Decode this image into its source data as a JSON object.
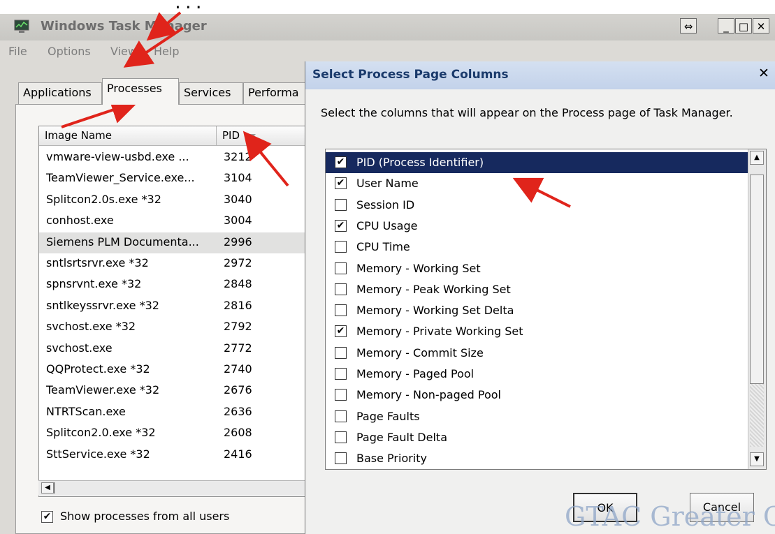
{
  "caption": "...",
  "window": {
    "title": "Windows Task Manager",
    "buttons": {
      "resize": "⇔",
      "minimize": "_",
      "maximize": "□",
      "close": "✕"
    }
  },
  "menu": [
    "File",
    "Options",
    "View",
    "Help"
  ],
  "tabs": [
    "Applications",
    "Processes",
    "Services",
    "Performa"
  ],
  "process_list": {
    "columns": {
      "image_name": "Image Name",
      "pid": "PID"
    },
    "rows": [
      {
        "name": "vmware-view-usbd.exe ...",
        "pid": "3212"
      },
      {
        "name": "TeamViewer_Service.exe...",
        "pid": "3104"
      },
      {
        "name": "Splitcon2.0s.exe *32",
        "pid": "3040"
      },
      {
        "name": "conhost.exe",
        "pid": "3004"
      },
      {
        "name": "Siemens PLM Documenta...",
        "pid": "2996"
      },
      {
        "name": "sntlsrtsrvr.exe *32",
        "pid": "2972"
      },
      {
        "name": "spnsrvnt.exe *32",
        "pid": "2848"
      },
      {
        "name": "sntlkeyssrvr.exe *32",
        "pid": "2816"
      },
      {
        "name": "svchost.exe *32",
        "pid": "2792"
      },
      {
        "name": "svchost.exe",
        "pid": "2772"
      },
      {
        "name": "QQProtect.exe *32",
        "pid": "2740"
      },
      {
        "name": "TeamViewer.exe *32",
        "pid": "2676"
      },
      {
        "name": "NTRTScan.exe",
        "pid": "2636"
      },
      {
        "name": "Splitcon2.0.exe *32",
        "pid": "2608"
      },
      {
        "name": "SttService.exe *32",
        "pid": "2416"
      }
    ],
    "selected_row": 4
  },
  "show_all": {
    "label": "Show processes from all users",
    "checked": true,
    "mark": "✔"
  },
  "dialog": {
    "title": "Select Process Page Columns",
    "close": "✕",
    "description": "Select the columns that will appear on the Process page of Task Manager.",
    "columns": [
      {
        "label": "PID (Process Identifier)",
        "checked": true,
        "mark": "✔"
      },
      {
        "label": "User Name",
        "checked": true,
        "mark": "✔"
      },
      {
        "label": "Session ID",
        "checked": false,
        "mark": ""
      },
      {
        "label": "CPU Usage",
        "checked": true,
        "mark": "✔"
      },
      {
        "label": "CPU Time",
        "checked": false,
        "mark": ""
      },
      {
        "label": "Memory - Working Set",
        "checked": false,
        "mark": ""
      },
      {
        "label": "Memory - Peak Working Set",
        "checked": false,
        "mark": ""
      },
      {
        "label": "Memory - Working Set Delta",
        "checked": false,
        "mark": ""
      },
      {
        "label": "Memory - Private Working Set",
        "checked": true,
        "mark": "✔"
      },
      {
        "label": "Memory - Commit Size",
        "checked": false,
        "mark": ""
      },
      {
        "label": "Memory - Paged Pool",
        "checked": false,
        "mark": ""
      },
      {
        "label": "Memory - Non-paged Pool",
        "checked": false,
        "mark": ""
      },
      {
        "label": "Page Faults",
        "checked": false,
        "mark": ""
      },
      {
        "label": "Page Fault Delta",
        "checked": false,
        "mark": ""
      },
      {
        "label": "Base Priority",
        "checked": false,
        "mark": ""
      }
    ],
    "selected_index": 0,
    "ok": "OK",
    "cancel": "Cancel"
  },
  "watermark": "GTAC Greater Ch",
  "colors": {
    "selection": "#16295e",
    "arrow": "#e0241b",
    "window_bg": "#dcdad6"
  },
  "icons": [
    "task-manager-icon",
    "sort-descending-icon",
    "scroll-up-icon",
    "scroll-down-icon",
    "scroll-left-icon",
    "annotation-arrow"
  ]
}
